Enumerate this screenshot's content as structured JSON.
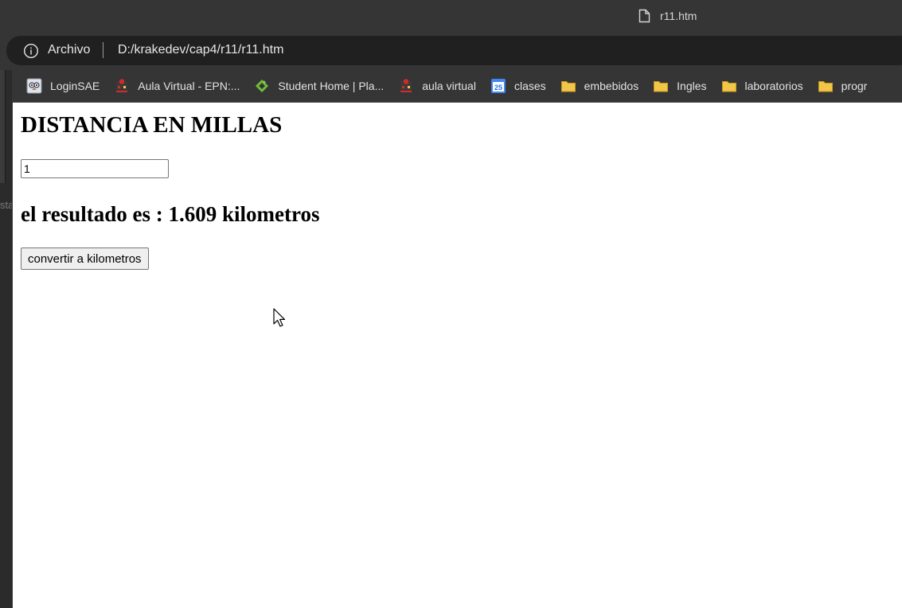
{
  "browser": {
    "tab_title": "r11.htm",
    "address": {
      "scheme_label": "Archivo",
      "url": "D:/krakedev/cap4/r11/r11.htm"
    },
    "left_strip_text": "sta",
    "bookmarks": [
      {
        "label": "LoginSAE",
        "icon": "owl-icon"
      },
      {
        "label": "Aula Virtual - EPN:...",
        "icon": "epn-icon"
      },
      {
        "label": "Student Home | Pla...",
        "icon": "student-home-icon"
      },
      {
        "label": "aula virtual",
        "icon": "epn-icon"
      },
      {
        "label": "clases",
        "icon": "calendar-icon"
      },
      {
        "label": "embebidos",
        "icon": "folder-icon"
      },
      {
        "label": "Ingles",
        "icon": "folder-icon"
      },
      {
        "label": "laboratorios",
        "icon": "folder-icon"
      },
      {
        "label": "progr",
        "icon": "folder-icon"
      }
    ]
  },
  "page": {
    "heading": "DISTANCIA EN MILLAS",
    "miles_input_value": "1",
    "result_text": "el resultado es : 1.609 kilometros",
    "convert_button_label": "convertir a kilometros"
  },
  "colors": {
    "chrome_bg": "#353535",
    "address_bg": "#202020",
    "folder": "#f2c649",
    "page_bg": "#ffffff"
  }
}
